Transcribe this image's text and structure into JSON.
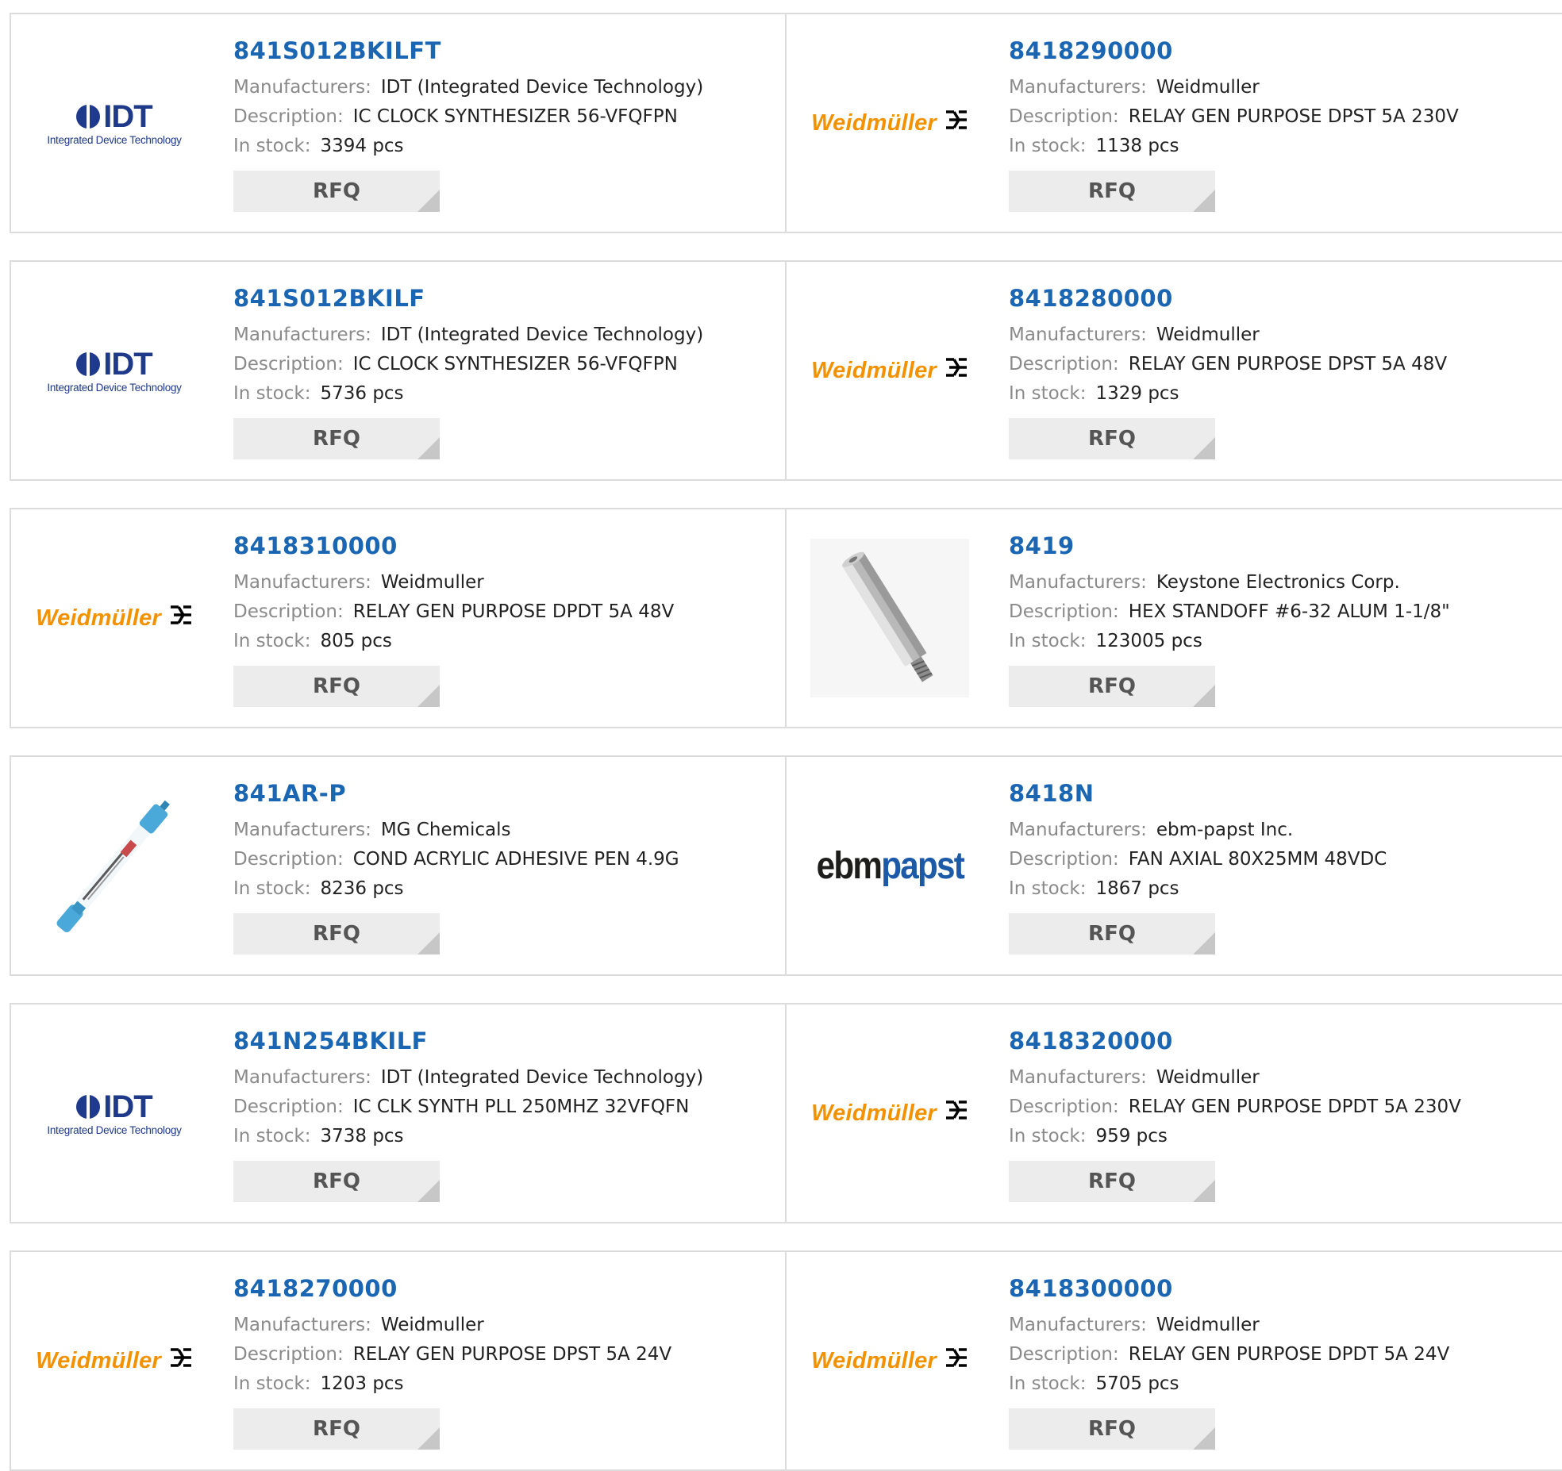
{
  "labels": {
    "manufacturers": "Manufacturers:",
    "description": "Description:",
    "in_stock": "In stock:",
    "rfq": "RFQ"
  },
  "logos": {
    "idt_mark": "IDT",
    "idt_sub": "Integrated Device Technology",
    "weidmuller": "Weidmüller",
    "weidmuller_symbol": "⟟",
    "ebm_a": "ebm",
    "ebm_b": "papst"
  },
  "products": [
    {
      "part": "841S012BKILFT",
      "manufacturer": "IDT (Integrated Device Technology)",
      "description": "IC CLOCK SYNTHESIZER 56-VFQFPN",
      "stock": "3394 pcs",
      "logo": "idt-logo"
    },
    {
      "part": "8418290000",
      "manufacturer": "Weidmuller",
      "description": "RELAY GEN PURPOSE DPST 5A 230V",
      "stock": "1138 pcs",
      "logo": "weidmuller-logo"
    },
    {
      "part": "841S012BKILF",
      "manufacturer": "IDT (Integrated Device Technology)",
      "description": "IC CLOCK SYNTHESIZER 56-VFQFPN",
      "stock": "5736 pcs",
      "logo": "idt-logo"
    },
    {
      "part": "8418280000",
      "manufacturer": "Weidmuller",
      "description": "RELAY GEN PURPOSE DPST 5A 48V",
      "stock": "1329 pcs",
      "logo": "weidmuller-logo"
    },
    {
      "part": "8418310000",
      "manufacturer": "Weidmuller",
      "description": "RELAY GEN PURPOSE DPDT 5A 48V",
      "stock": "805 pcs",
      "logo": "weidmuller-logo"
    },
    {
      "part": "8419",
      "manufacturer": "Keystone Electronics Corp.",
      "description": "HEX STANDOFF #6-32 ALUM 1-1/8\"",
      "stock": "123005 pcs",
      "logo": "hex-standoff-image"
    },
    {
      "part": "841AR-P",
      "manufacturer": "MG Chemicals",
      "description": "COND ACRYLIC ADHESIVE PEN 4.9G",
      "stock": "8236 pcs",
      "logo": "adhesive-pen-image"
    },
    {
      "part": "8418N",
      "manufacturer": "ebm-papst Inc.",
      "description": "FAN AXIAL 80X25MM 48VDC",
      "stock": "1867 pcs",
      "logo": "ebmpapst-logo"
    },
    {
      "part": "841N254BKILF",
      "manufacturer": "IDT (Integrated Device Technology)",
      "description": "IC CLK SYNTH PLL 250MHZ 32VFQFN",
      "stock": "3738 pcs",
      "logo": "idt-logo"
    },
    {
      "part": "8418320000",
      "manufacturer": "Weidmuller",
      "description": "RELAY GEN PURPOSE DPDT 5A 230V",
      "stock": "959 pcs",
      "logo": "weidmuller-logo"
    },
    {
      "part": "8418270000",
      "manufacturer": "Weidmuller",
      "description": "RELAY GEN PURPOSE DPST 5A 24V",
      "stock": "1203 pcs",
      "logo": "weidmuller-logo"
    },
    {
      "part": "8418300000",
      "manufacturer": "Weidmuller",
      "description": "RELAY GEN PURPOSE DPDT 5A 24V",
      "stock": "5705 pcs",
      "logo": "weidmuller-logo"
    }
  ],
  "colors": {
    "part_link": "#1a66b3",
    "weidmuller_orange": "#f39200",
    "idt_blue": "#1f3a8a",
    "ebm_blue": "#1c5aa8"
  }
}
